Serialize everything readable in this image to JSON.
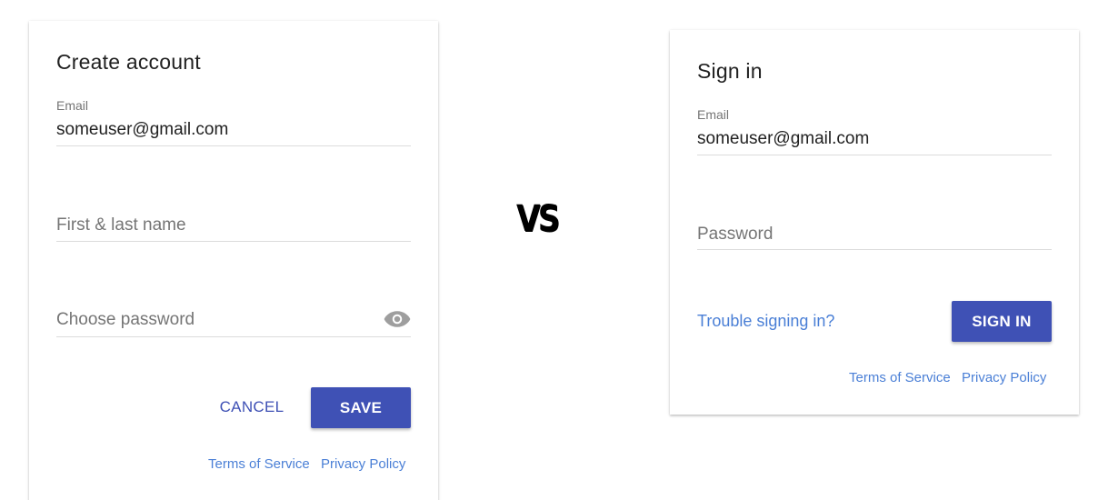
{
  "colors": {
    "primary": "#3f51b5",
    "link": "#4a7fd6",
    "text": "#212121",
    "muted": "#757575",
    "divider": "#dcdcdc"
  },
  "create_account": {
    "title": "Create account",
    "email_label": "Email",
    "email_value": "someuser@gmail.com",
    "name_placeholder": "First & last name",
    "password_placeholder": "Choose password",
    "password_toggle_icon": "eye-icon",
    "cancel_label": "CANCEL",
    "save_label": "SAVE",
    "terms_link": "Terms of Service",
    "privacy_link": "Privacy Policy"
  },
  "separator": {
    "text": "VS"
  },
  "sign_in": {
    "title": "Sign in",
    "email_label": "Email",
    "email_value": "someuser@gmail.com",
    "password_placeholder": "Password",
    "trouble_link": "Trouble signing in?",
    "signin_label": "SIGN IN",
    "terms_link": "Terms of Service",
    "privacy_link": "Privacy Policy"
  }
}
